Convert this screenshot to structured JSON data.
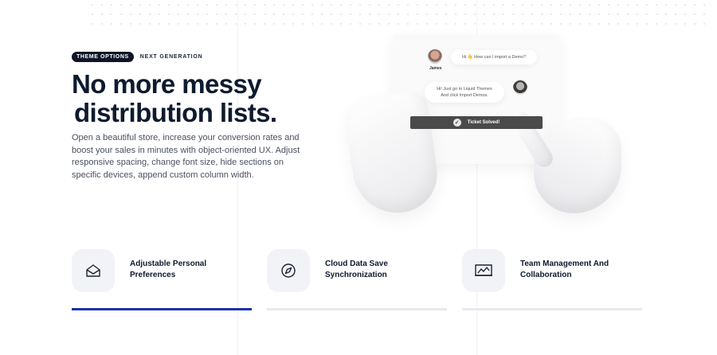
{
  "hero": {
    "badge": "THEME OPTIONS",
    "eyebrow": "NEXT GENERATION",
    "headline_line1": "No more messy",
    "headline_line2": "distribution lists.",
    "description": "Open a beautiful store, increase your conversion rates and boost your sales in minutes with object-oriented UX. Adjust responsive spacing, change font size, hide sections on specific devices, append custom column width."
  },
  "mockup": {
    "user1_name": "James",
    "user1_message": "Hi 👋 How can I import a Demo?",
    "user2_message": "Hi! Just go to Liquid Themes And click Import Demos.",
    "ticket_label": "Ticket Solved!"
  },
  "features": [
    {
      "label": "Adjustable Personal Preferences",
      "icon": "envelope-icon",
      "active": true
    },
    {
      "label": "Cloud Data Save Synchronization",
      "icon": "compass-icon",
      "active": false
    },
    {
      "label": "Team Management And Collaboration",
      "icon": "chart-monitor-icon",
      "active": false
    }
  ],
  "colors": {
    "accent": "#1b33a6",
    "heading": "#0e1a2e",
    "badge_bg": "#0e1526",
    "icon_box_bg": "#f1f3f7"
  }
}
